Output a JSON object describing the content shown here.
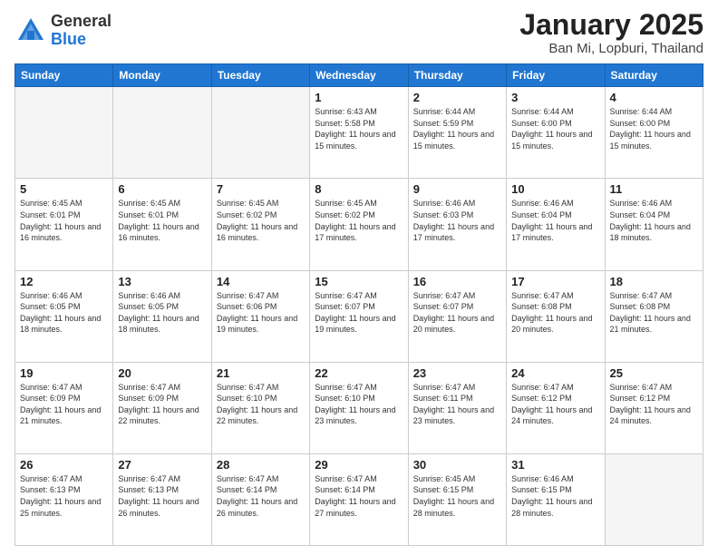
{
  "logo": {
    "general": "General",
    "blue": "Blue"
  },
  "title": "January 2025",
  "location": "Ban Mi, Lopburi, Thailand",
  "weekdays": [
    "Sunday",
    "Monday",
    "Tuesday",
    "Wednesday",
    "Thursday",
    "Friday",
    "Saturday"
  ],
  "weeks": [
    [
      {
        "day": "",
        "info": ""
      },
      {
        "day": "",
        "info": ""
      },
      {
        "day": "",
        "info": ""
      },
      {
        "day": "1",
        "info": "Sunrise: 6:43 AM\nSunset: 5:58 PM\nDaylight: 11 hours and 15 minutes."
      },
      {
        "day": "2",
        "info": "Sunrise: 6:44 AM\nSunset: 5:59 PM\nDaylight: 11 hours and 15 minutes."
      },
      {
        "day": "3",
        "info": "Sunrise: 6:44 AM\nSunset: 6:00 PM\nDaylight: 11 hours and 15 minutes."
      },
      {
        "day": "4",
        "info": "Sunrise: 6:44 AM\nSunset: 6:00 PM\nDaylight: 11 hours and 15 minutes."
      }
    ],
    [
      {
        "day": "5",
        "info": "Sunrise: 6:45 AM\nSunset: 6:01 PM\nDaylight: 11 hours and 16 minutes."
      },
      {
        "day": "6",
        "info": "Sunrise: 6:45 AM\nSunset: 6:01 PM\nDaylight: 11 hours and 16 minutes."
      },
      {
        "day": "7",
        "info": "Sunrise: 6:45 AM\nSunset: 6:02 PM\nDaylight: 11 hours and 16 minutes."
      },
      {
        "day": "8",
        "info": "Sunrise: 6:45 AM\nSunset: 6:02 PM\nDaylight: 11 hours and 17 minutes."
      },
      {
        "day": "9",
        "info": "Sunrise: 6:46 AM\nSunset: 6:03 PM\nDaylight: 11 hours and 17 minutes."
      },
      {
        "day": "10",
        "info": "Sunrise: 6:46 AM\nSunset: 6:04 PM\nDaylight: 11 hours and 17 minutes."
      },
      {
        "day": "11",
        "info": "Sunrise: 6:46 AM\nSunset: 6:04 PM\nDaylight: 11 hours and 18 minutes."
      }
    ],
    [
      {
        "day": "12",
        "info": "Sunrise: 6:46 AM\nSunset: 6:05 PM\nDaylight: 11 hours and 18 minutes."
      },
      {
        "day": "13",
        "info": "Sunrise: 6:46 AM\nSunset: 6:05 PM\nDaylight: 11 hours and 18 minutes."
      },
      {
        "day": "14",
        "info": "Sunrise: 6:47 AM\nSunset: 6:06 PM\nDaylight: 11 hours and 19 minutes."
      },
      {
        "day": "15",
        "info": "Sunrise: 6:47 AM\nSunset: 6:07 PM\nDaylight: 11 hours and 19 minutes."
      },
      {
        "day": "16",
        "info": "Sunrise: 6:47 AM\nSunset: 6:07 PM\nDaylight: 11 hours and 20 minutes."
      },
      {
        "day": "17",
        "info": "Sunrise: 6:47 AM\nSunset: 6:08 PM\nDaylight: 11 hours and 20 minutes."
      },
      {
        "day": "18",
        "info": "Sunrise: 6:47 AM\nSunset: 6:08 PM\nDaylight: 11 hours and 21 minutes."
      }
    ],
    [
      {
        "day": "19",
        "info": "Sunrise: 6:47 AM\nSunset: 6:09 PM\nDaylight: 11 hours and 21 minutes."
      },
      {
        "day": "20",
        "info": "Sunrise: 6:47 AM\nSunset: 6:09 PM\nDaylight: 11 hours and 22 minutes."
      },
      {
        "day": "21",
        "info": "Sunrise: 6:47 AM\nSunset: 6:10 PM\nDaylight: 11 hours and 22 minutes."
      },
      {
        "day": "22",
        "info": "Sunrise: 6:47 AM\nSunset: 6:10 PM\nDaylight: 11 hours and 23 minutes."
      },
      {
        "day": "23",
        "info": "Sunrise: 6:47 AM\nSunset: 6:11 PM\nDaylight: 11 hours and 23 minutes."
      },
      {
        "day": "24",
        "info": "Sunrise: 6:47 AM\nSunset: 6:12 PM\nDaylight: 11 hours and 24 minutes."
      },
      {
        "day": "25",
        "info": "Sunrise: 6:47 AM\nSunset: 6:12 PM\nDaylight: 11 hours and 24 minutes."
      }
    ],
    [
      {
        "day": "26",
        "info": "Sunrise: 6:47 AM\nSunset: 6:13 PM\nDaylight: 11 hours and 25 minutes."
      },
      {
        "day": "27",
        "info": "Sunrise: 6:47 AM\nSunset: 6:13 PM\nDaylight: 11 hours and 26 minutes."
      },
      {
        "day": "28",
        "info": "Sunrise: 6:47 AM\nSunset: 6:14 PM\nDaylight: 11 hours and 26 minutes."
      },
      {
        "day": "29",
        "info": "Sunrise: 6:47 AM\nSunset: 6:14 PM\nDaylight: 11 hours and 27 minutes."
      },
      {
        "day": "30",
        "info": "Sunrise: 6:45 AM\nSunset: 6:15 PM\nDaylight: 11 hours and 28 minutes."
      },
      {
        "day": "31",
        "info": "Sunrise: 6:46 AM\nSunset: 6:15 PM\nDaylight: 11 hours and 28 minutes."
      },
      {
        "day": "",
        "info": ""
      }
    ]
  ]
}
